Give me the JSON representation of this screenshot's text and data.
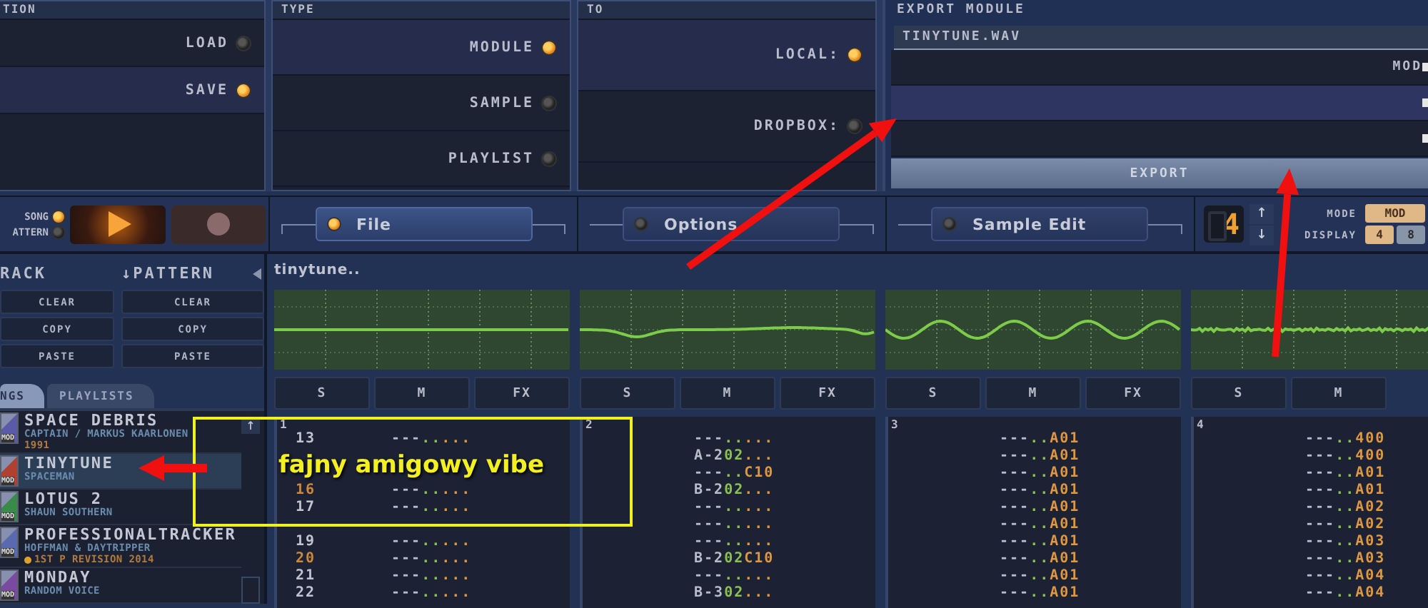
{
  "panels": [
    {
      "header": "TION",
      "options": [
        {
          "label": "LOAD",
          "selected": false
        },
        {
          "label": "SAVE",
          "selected": true
        }
      ]
    },
    {
      "header": "TYPE",
      "options": [
        {
          "label": "MODULE",
          "selected": true
        },
        {
          "label": "SAMPLE",
          "selected": false
        },
        {
          "label": "PLAYLIST",
          "selected": false
        }
      ]
    },
    {
      "header": "TO",
      "options": [
        {
          "label": "LOCAL:",
          "selected": true
        },
        {
          "label": "DROPBOX:",
          "selected": false
        }
      ]
    }
  ],
  "export_module": {
    "title": "EXPORT MODULE",
    "filename": "TINYTUNE.WAV",
    "rows": [
      {
        "label": "MOD",
        "selected": false
      },
      {
        "selected": true
      },
      {
        "selected": false
      }
    ],
    "button": "EXPORT"
  },
  "transport": {
    "modes": [
      {
        "label": "SONG",
        "selected": true
      },
      {
        "label": "ATTERN",
        "selected": false
      }
    ]
  },
  "nav_tabs": [
    {
      "label": "File",
      "selected": true
    },
    {
      "label": "Options",
      "selected": false
    },
    {
      "label": "Sample Edit",
      "selected": false
    }
  ],
  "pattern_counter": {
    "value": "4",
    "up": "↑",
    "down": "↓"
  },
  "mode": {
    "label": "MODE",
    "options": [
      {
        "label": "MOD",
        "selected": true
      }
    ]
  },
  "display": {
    "label": "DISPLAY",
    "options": [
      {
        "label": "4",
        "selected": true
      },
      {
        "label": "8",
        "selected": false
      }
    ]
  },
  "edit_columns": [
    {
      "title": "RACK",
      "buttons": [
        "CLEAR",
        "COPY",
        "PASTE"
      ]
    },
    {
      "title": "↓PATTERN",
      "buttons": [
        "CLEAR",
        "COPY",
        "PASTE"
      ]
    }
  ],
  "library": {
    "tabs": [
      {
        "label": "NGS",
        "selected": true
      },
      {
        "label": "PLAYLISTS",
        "selected": false
      }
    ],
    "scroll_up": "↑",
    "items": [
      {
        "title": "SPACE DEBRIS",
        "author": "CAPTAIN / MARKUS KAARLONEN",
        "info": "1991",
        "award": false,
        "badge": "MOD",
        "color": "#5a5aa8",
        "selected": false
      },
      {
        "title": "TINYTUNE",
        "author": "SPACEMAN",
        "award": false,
        "badge": "MOD",
        "color": "#b04030",
        "selected": true
      },
      {
        "title": "LOTUS 2",
        "author": "SHAUN SOUTHERN",
        "award": false,
        "badge": "MOD",
        "color": "#3a8a4a",
        "selected": false
      },
      {
        "title": "PROFESSIONALTRACKER",
        "author": "HOFFMAN & DAYTRIPPER",
        "info": "1ST P REVISION 2014",
        "award": true,
        "badge": "MOD",
        "color": "#5a6ab0",
        "selected": false
      },
      {
        "title": "MONDAY",
        "author": "RANDOM VOICE",
        "award": false,
        "badge": "MOD",
        "color": "#7a4aa0",
        "selected": false
      }
    ]
  },
  "song_title": "tinytune..",
  "channels": [
    {
      "number": "1",
      "kind": "flat",
      "buttons": [
        "S",
        "M",
        "FX"
      ]
    },
    {
      "number": "2",
      "kind": "dip",
      "buttons": [
        "S",
        "M",
        "FX"
      ]
    },
    {
      "number": "3",
      "kind": "sine",
      "buttons": [
        "S",
        "M",
        "FX"
      ]
    },
    {
      "number": "4",
      "kind": "noise",
      "buttons": [
        "S",
        "M"
      ]
    }
  ],
  "pattern_rows": [
    {
      "number": "13",
      "accent": false,
      "cells": [
        [
          "---",
          "..",
          "..."
        ],
        [
          "---",
          "..",
          "..."
        ],
        [
          "---",
          "..",
          "A01"
        ],
        [
          "---",
          "..",
          "400"
        ]
      ]
    },
    {
      "cells": [
        null,
        [
          "A-2",
          "02",
          "..."
        ],
        [
          "---",
          "..",
          "A01"
        ],
        [
          "---",
          "..",
          "400"
        ]
      ]
    },
    {
      "cells": [
        null,
        [
          "---",
          "..",
          "C10"
        ],
        [
          "---",
          "..",
          "A01"
        ],
        [
          "---",
          "..",
          "A01"
        ]
      ]
    },
    {
      "number": "16",
      "accent": true,
      "cells": [
        [
          "---",
          "..",
          "..."
        ],
        [
          "B-2",
          "02",
          "..."
        ],
        [
          "---",
          "..",
          "A01"
        ],
        [
          "---",
          "..",
          "A01"
        ]
      ]
    },
    {
      "number": "17",
      "accent": false,
      "cells": [
        [
          "---",
          "..",
          "..."
        ],
        [
          "---",
          "..",
          "..."
        ],
        [
          "---",
          "..",
          "A01"
        ],
        [
          "---",
          "..",
          "A02"
        ]
      ]
    },
    {
      "cells": [
        null,
        [
          "---",
          "..",
          "..."
        ],
        [
          "---",
          "..",
          "A01"
        ],
        [
          "---",
          "..",
          "A02"
        ]
      ]
    },
    {
      "number": "19",
      "accent": false,
      "cells": [
        [
          "---",
          "..",
          "..."
        ],
        [
          "---",
          "..",
          "..."
        ],
        [
          "---",
          "..",
          "A01"
        ],
        [
          "---",
          "..",
          "A03"
        ]
      ]
    },
    {
      "number": "20",
      "accent": true,
      "cells": [
        [
          "---",
          "..",
          "..."
        ],
        [
          "B-2",
          "02",
          "C10"
        ],
        [
          "---",
          "..",
          "A01"
        ],
        [
          "---",
          "..",
          "A03"
        ]
      ]
    },
    {
      "number": "21",
      "accent": false,
      "cells": [
        [
          "---",
          "..",
          "..."
        ],
        [
          "---",
          "..",
          "..."
        ],
        [
          "---",
          "..",
          "A01"
        ],
        [
          "---",
          "..",
          "A04"
        ]
      ]
    },
    {
      "number": "22",
      "accent": false,
      "cells": [
        [
          "---",
          "..",
          "..."
        ],
        [
          "B-3",
          "02",
          "..."
        ],
        [
          "---",
          "..",
          "A01"
        ],
        [
          "---",
          "..",
          "A04"
        ]
      ]
    }
  ],
  "annotation": {
    "note": "fajny amigowy vibe"
  }
}
